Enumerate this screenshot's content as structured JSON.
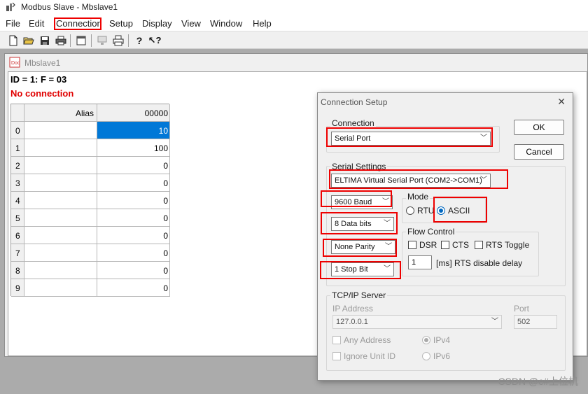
{
  "window": {
    "title": "Modbus Slave - Mbslave1"
  },
  "menu": [
    "File",
    "Edit",
    "Connection",
    "Setup",
    "Display",
    "View",
    "Window",
    "Help"
  ],
  "toolbar": [
    "new-icon",
    "open-icon",
    "save-icon",
    "print-icon",
    "window-icon",
    "monitor-icon",
    "printer-icon",
    "help-icon",
    "context-help-icon"
  ],
  "child": {
    "title": "Mbslave1",
    "id_line": "ID = 1: F = 03",
    "status": "No connection"
  },
  "grid": {
    "alias_header": "Alias",
    "value_header": "00000",
    "rows": [
      {
        "num": "0",
        "value": "10"
      },
      {
        "num": "1",
        "value": "100"
      },
      {
        "num": "2",
        "value": "0"
      },
      {
        "num": "3",
        "value": "0"
      },
      {
        "num": "4",
        "value": "0"
      },
      {
        "num": "5",
        "value": "0"
      },
      {
        "num": "6",
        "value": "0"
      },
      {
        "num": "7",
        "value": "0"
      },
      {
        "num": "8",
        "value": "0"
      },
      {
        "num": "9",
        "value": "0"
      }
    ]
  },
  "dialog": {
    "title": "Connection Setup",
    "close": "✕",
    "ok_label": "OK",
    "cancel_label": "Cancel",
    "connection_label": "Connection",
    "connection_value": "Serial Port",
    "serial_label": "Serial Settings",
    "port_value": "ELTIMA Virtual Serial Port (COM2->COM1)",
    "baud_value": "9600 Baud",
    "data_bits_value": "8 Data bits",
    "parity_value": "None Parity",
    "stop_bits_value": "1 Stop Bit",
    "mode_label": "Mode",
    "rtu_label": "RTU",
    "ascii_label": "ASCII",
    "flow_label": "Flow Control",
    "dsr_label": "DSR",
    "cts_label": "CTS",
    "rts_toggle_label": "RTS Toggle",
    "rts_delay_value": "1",
    "rts_delay_label": "[ms] RTS disable delay",
    "tcp_label": "TCP/IP Server",
    "ip_label": "IP Address",
    "ip_value": "127.0.0.1",
    "port_label": "Port",
    "port_number": "502",
    "any_address_label": "Any Address",
    "ignore_unit_label": "Ignore Unit ID",
    "ipv4_label": "IPv4",
    "ipv6_label": "IPv6",
    "mode_selected": "ASCII"
  },
  "watermark": "CSDN @c#上位机",
  "colors": {
    "highlight": "#ee0000",
    "selection": "#0078d7",
    "status_red": "#e00000"
  }
}
